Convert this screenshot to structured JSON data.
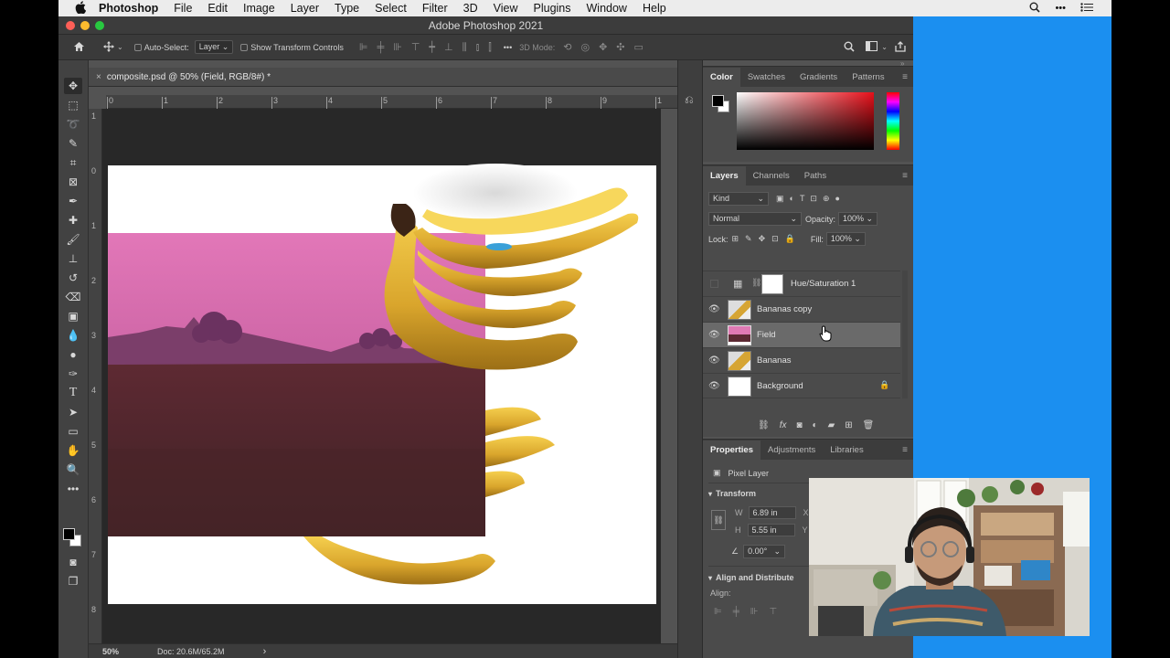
{
  "menubar": {
    "apple": "",
    "items": [
      "Photoshop",
      "File",
      "Edit",
      "Image",
      "Layer",
      "Type",
      "Select",
      "Filter",
      "3D",
      "View",
      "Plugins",
      "Window",
      "Help"
    ]
  },
  "window": {
    "title": "Adobe Photoshop 2021"
  },
  "options": {
    "auto_select_label": "Auto-Select:",
    "auto_select_target": "Layer",
    "transform_label": "Show Transform Controls",
    "mode3d_label": "3D Mode:",
    "more": "•••"
  },
  "document": {
    "tab_title": "composite.psd @ 50% (Field, RGB/8#) *",
    "ruler_top": [
      "0",
      "1",
      "2",
      "3",
      "4",
      "5",
      "6",
      "7",
      "8",
      "9",
      "1"
    ],
    "ruler_left": [
      "1",
      "0",
      "1",
      "2",
      "3",
      "4",
      "5",
      "6",
      "7",
      "8"
    ]
  },
  "status": {
    "zoom": "50%",
    "doc": "Doc: 20.6M/65.2M",
    "arrow": "›"
  },
  "color_panel": {
    "tabs": [
      "Color",
      "Swatches",
      "Gradients",
      "Patterns"
    ]
  },
  "layers_panel": {
    "tabs": [
      "Layers",
      "Channels",
      "Paths"
    ],
    "filter": "Kind",
    "blend_mode": "Normal",
    "opacity_label": "Opacity:",
    "opacity_value": "100%",
    "lock_label": "Lock:",
    "fill_label": "Fill:",
    "fill_value": "100%",
    "layers": [
      {
        "name": "Hue/Saturation 1"
      },
      {
        "name": "Bananas copy"
      },
      {
        "name": "Field"
      },
      {
        "name": "Bananas"
      },
      {
        "name": "Background"
      }
    ],
    "footer_icons": [
      "link",
      "fx",
      "mask",
      "adjustment",
      "folder",
      "new",
      "trash"
    ]
  },
  "properties_panel": {
    "tabs": [
      "Properties",
      "Adjustments",
      "Libraries"
    ],
    "kind": "Pixel Layer",
    "transform_heading": "Transform",
    "w_label": "W",
    "w_value": "6.89 in",
    "h_label": "H",
    "h_value": "5.55 in",
    "x_label": "X",
    "y_label": "Y",
    "angle_value": "0.00°",
    "align_heading": "Align and Distribute",
    "align_label": "Align:"
  },
  "colors": {
    "app_bg": "#535353",
    "panel_bg": "#4b4b4b",
    "desktop": "#1b8ff0",
    "selected_layer": "#6a6a6a"
  }
}
